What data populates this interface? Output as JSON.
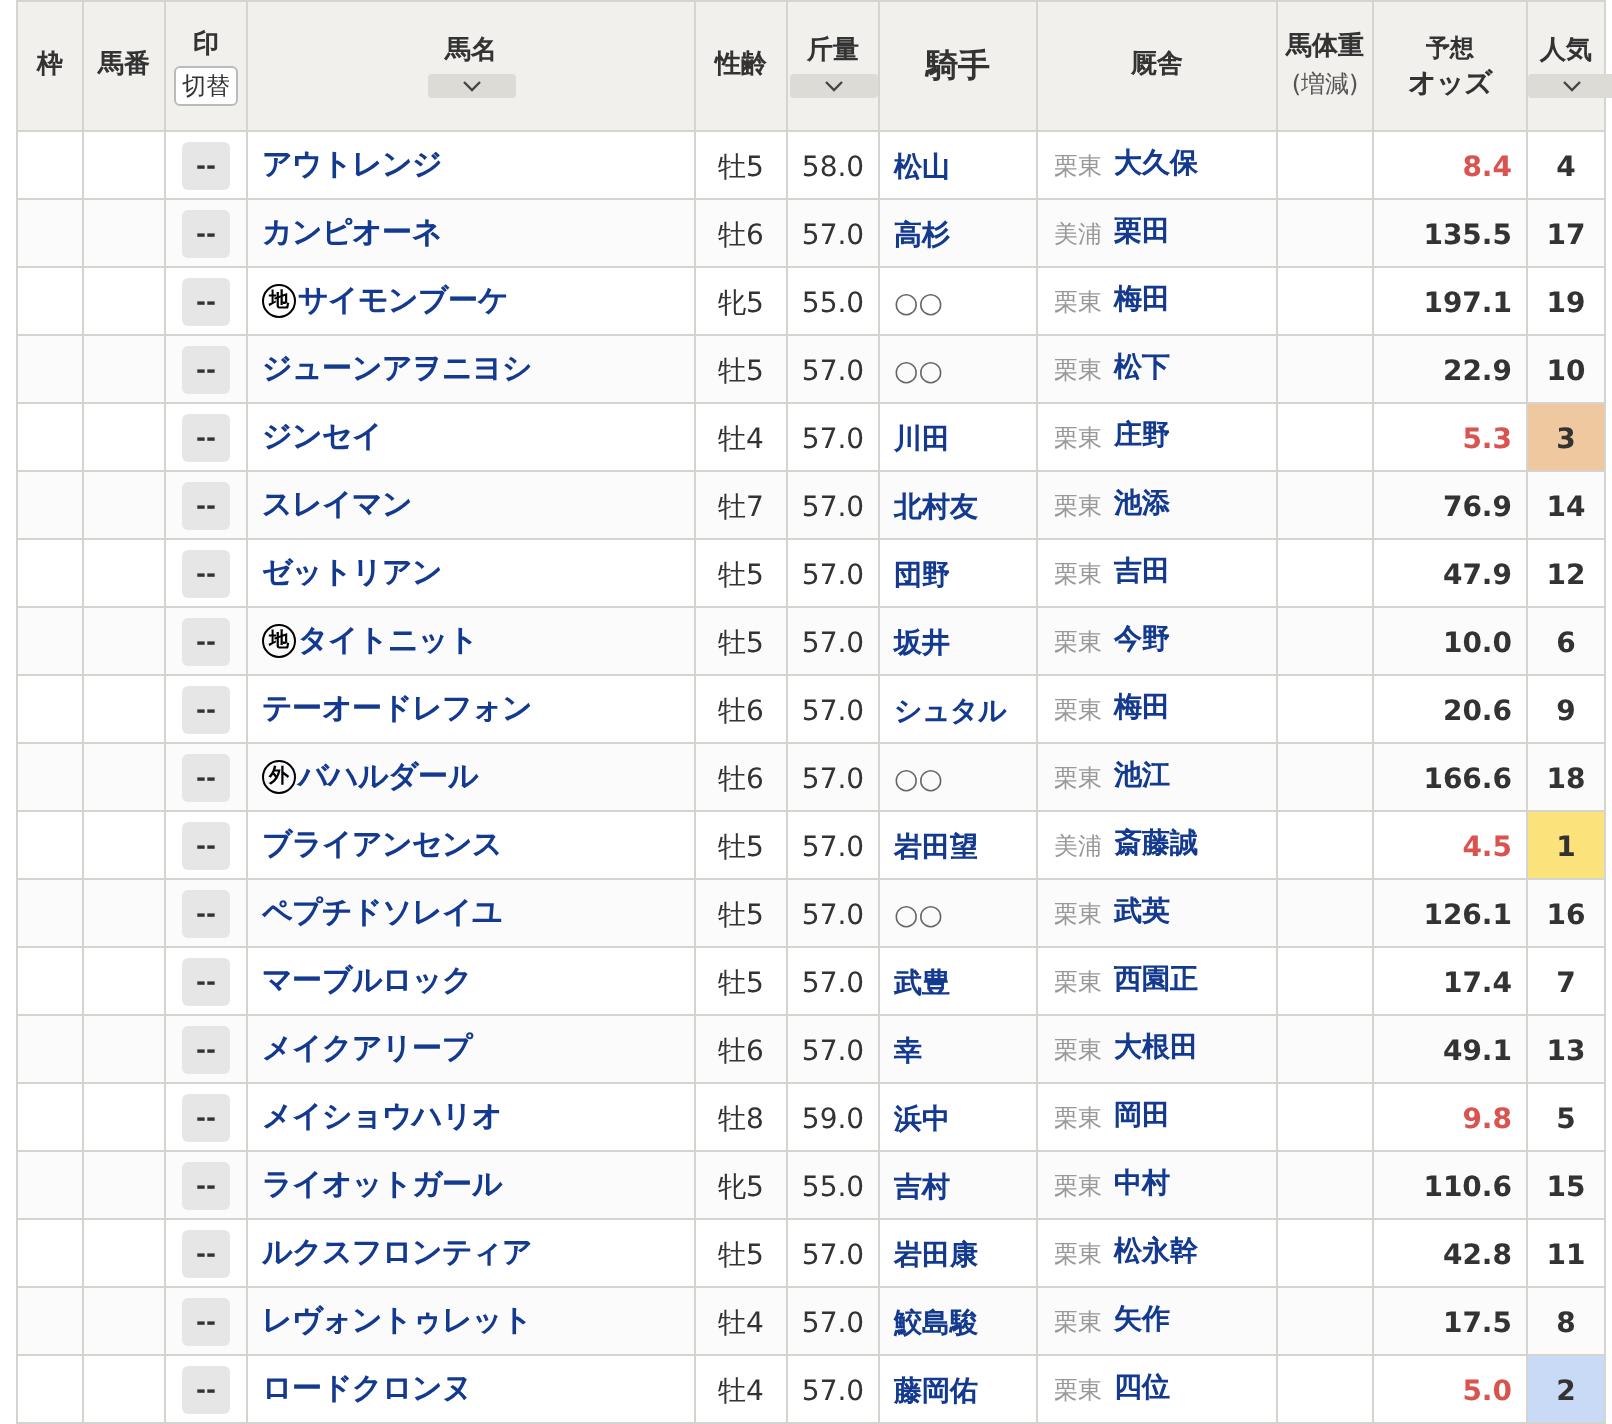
{
  "table": {
    "columns": [
      {
        "label": "枠"
      },
      {
        "label": "馬番"
      },
      {
        "label": "印",
        "button": "切替"
      },
      {
        "label": "馬名",
        "sortable": true
      },
      {
        "label": "性齢"
      },
      {
        "label": "斤量",
        "sortable": true
      },
      {
        "label": "騎手",
        "large": true
      },
      {
        "label": "厩舎"
      },
      {
        "label": "馬体重",
        "sub": "(増減)"
      },
      {
        "label": "予想",
        "sub": "オッズ",
        "stacked_bold": true
      },
      {
        "label": "人気",
        "sortable": true
      }
    ],
    "rows": [
      {
        "mark_button": "--",
        "name": "アウトレンジ",
        "sex_age": "牡5",
        "weight": "58.0",
        "jockey": "松山",
        "jockey_linked": true,
        "region": "栗東",
        "trainer": "大久保",
        "odds": "8.4",
        "odds_hot": true,
        "popularity": "4"
      },
      {
        "mark_button": "--",
        "name": "カンピオーネ",
        "sex_age": "牡6",
        "weight": "57.0",
        "jockey": "高杉",
        "jockey_linked": true,
        "region": "美浦",
        "trainer": "栗田",
        "odds": "135.5",
        "odds_hot": false,
        "popularity": "17"
      },
      {
        "mark_button": "--",
        "badge": "地",
        "name": "サイモンブーケ",
        "sex_age": "牝5",
        "weight": "55.0",
        "jockey": "○○",
        "jockey_linked": false,
        "region": "栗東",
        "trainer": "梅田",
        "odds": "197.1",
        "odds_hot": false,
        "popularity": "19"
      },
      {
        "mark_button": "--",
        "name": "ジューンアヲニヨシ",
        "sex_age": "牡5",
        "weight": "57.0",
        "jockey": "○○",
        "jockey_linked": false,
        "region": "栗東",
        "trainer": "松下",
        "odds": "22.9",
        "odds_hot": false,
        "popularity": "10"
      },
      {
        "mark_button": "--",
        "name": "ジンセイ",
        "sex_age": "牡4",
        "weight": "57.0",
        "jockey": "川田",
        "jockey_linked": true,
        "region": "栗東",
        "trainer": "庄野",
        "odds": "5.3",
        "odds_hot": true,
        "popularity": "3",
        "color": "#f0c8a0"
      },
      {
        "mark_button": "--",
        "name": "スレイマン",
        "sex_age": "牡7",
        "weight": "57.0",
        "jockey": "北村友",
        "jockey_linked": true,
        "region": "栗東",
        "trainer": "池添",
        "odds": "76.9",
        "odds_hot": false,
        "popularity": "14"
      },
      {
        "mark_button": "--",
        "name": "ゼットリアン",
        "sex_age": "牡5",
        "weight": "57.0",
        "jockey": "団野",
        "jockey_linked": true,
        "region": "栗東",
        "trainer": "吉田",
        "odds": "47.9",
        "odds_hot": false,
        "popularity": "12"
      },
      {
        "mark_button": "--",
        "badge": "地",
        "name": "タイトニット",
        "sex_age": "牡5",
        "weight": "57.0",
        "jockey": "坂井",
        "jockey_linked": true,
        "region": "栗東",
        "trainer": "今野",
        "odds": "10.0",
        "odds_hot": false,
        "popularity": "6"
      },
      {
        "mark_button": "--",
        "name": "テーオードレフォン",
        "sex_age": "牡6",
        "weight": "57.0",
        "jockey": "シュタル",
        "jockey_linked": true,
        "region": "栗東",
        "trainer": "梅田",
        "odds": "20.6",
        "odds_hot": false,
        "popularity": "9"
      },
      {
        "mark_button": "--",
        "badge": "外",
        "name": "バハルダール",
        "sex_age": "牡6",
        "weight": "57.0",
        "jockey": "○○",
        "jockey_linked": false,
        "region": "栗東",
        "trainer": "池江",
        "odds": "166.6",
        "odds_hot": false,
        "popularity": "18"
      },
      {
        "mark_button": "--",
        "name": "ブライアンセンス",
        "sex_age": "牡5",
        "weight": "57.0",
        "jockey": "岩田望",
        "jockey_linked": true,
        "region": "美浦",
        "trainer": "斎藤誠",
        "odds": "4.5",
        "odds_hot": true,
        "popularity": "1",
        "color": "#fbe27a"
      },
      {
        "mark_button": "--",
        "name": "ペプチドソレイユ",
        "sex_age": "牡5",
        "weight": "57.0",
        "jockey": "○○",
        "jockey_linked": false,
        "region": "栗東",
        "trainer": "武英",
        "odds": "126.1",
        "odds_hot": false,
        "popularity": "16"
      },
      {
        "mark_button": "--",
        "name": "マーブルロック",
        "sex_age": "牡5",
        "weight": "57.0",
        "jockey": "武豊",
        "jockey_linked": true,
        "region": "栗東",
        "trainer": "西園正",
        "odds": "17.4",
        "odds_hot": false,
        "popularity": "7"
      },
      {
        "mark_button": "--",
        "name": "メイクアリープ",
        "sex_age": "牡6",
        "weight": "57.0",
        "jockey": "幸",
        "jockey_linked": true,
        "region": "栗東",
        "trainer": "大根田",
        "odds": "49.1",
        "odds_hot": false,
        "popularity": "13"
      },
      {
        "mark_button": "--",
        "name": "メイショウハリオ",
        "sex_age": "牡8",
        "weight": "59.0",
        "jockey": "浜中",
        "jockey_linked": true,
        "region": "栗東",
        "trainer": "岡田",
        "odds": "9.8",
        "odds_hot": true,
        "popularity": "5"
      },
      {
        "mark_button": "--",
        "name": "ライオットガール",
        "sex_age": "牝5",
        "weight": "55.0",
        "jockey": "吉村",
        "jockey_linked": true,
        "region": "栗東",
        "trainer": "中村",
        "odds": "110.6",
        "odds_hot": false,
        "popularity": "15"
      },
      {
        "mark_button": "--",
        "name": "ルクスフロンティア",
        "sex_age": "牡5",
        "weight": "57.0",
        "jockey": "岩田康",
        "jockey_linked": true,
        "region": "栗東",
        "trainer": "松永幹",
        "odds": "42.8",
        "odds_hot": false,
        "popularity": "11"
      },
      {
        "mark_button": "--",
        "name": "レヴォントゥレット",
        "sex_age": "牡4",
        "weight": "57.0",
        "jockey": "鮫島駿",
        "jockey_linked": true,
        "region": "栗東",
        "trainer": "矢作",
        "odds": "17.5",
        "odds_hot": false,
        "popularity": "8"
      },
      {
        "mark_button": "--",
        "name": "ロードクロンヌ",
        "sex_age": "牡4",
        "weight": "57.0",
        "jockey": "藤岡佑",
        "jockey_linked": true,
        "region": "栗東",
        "trainer": "四位",
        "odds": "5.0",
        "odds_hot": true,
        "popularity": "2",
        "color": "#c8daf5"
      }
    ]
  }
}
